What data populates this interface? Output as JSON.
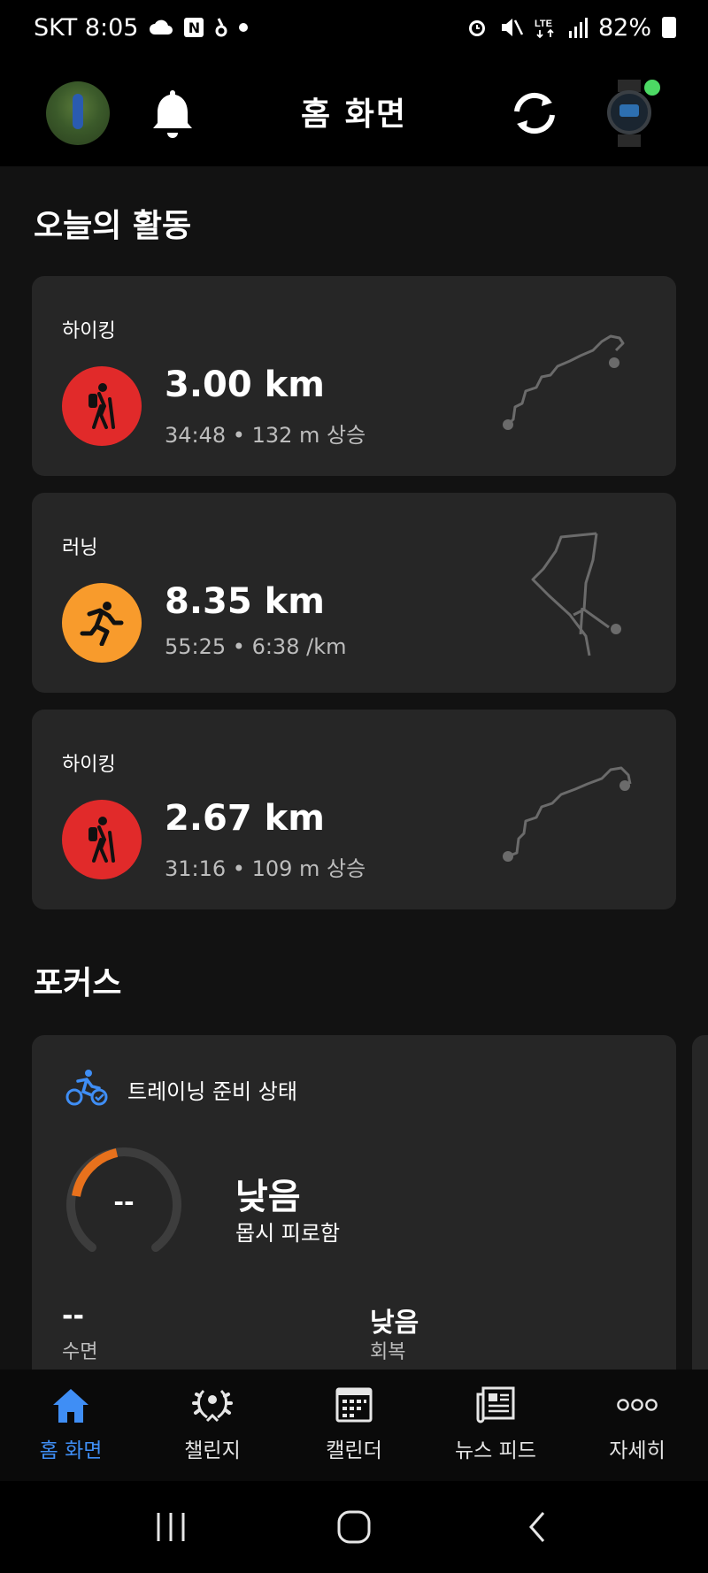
{
  "status_bar": {
    "carrier_time": "SKT 8:05",
    "n_badge": "N",
    "right_text": "82%"
  },
  "header": {
    "title": "홈 화면"
  },
  "today": {
    "title": "오늘의 활동",
    "activities": [
      {
        "type": "하이킹",
        "distance": "3.00 km",
        "sub": "34:48 • 132 m 상승",
        "color": "#e12a2a"
      },
      {
        "type": "러닝",
        "distance": "8.35 km",
        "sub": "55:25 • 6:38 /km",
        "color": "#f89b2c"
      },
      {
        "type": "하이킹",
        "distance": "2.67 km",
        "sub": "31:16 • 109 m 상승",
        "color": "#e12a2a"
      }
    ]
  },
  "focus": {
    "title": "포커스",
    "card_title": "트레이닝 준비 상태",
    "gauge_value": "--",
    "status": "낮음",
    "description": "몹시 피로함",
    "stats": [
      {
        "value": "--",
        "label": "수면"
      },
      {
        "value": "낮음",
        "label": "회복"
      }
    ]
  },
  "bottom_nav": {
    "items": [
      {
        "label": "홈 화면",
        "icon": "home-icon",
        "active": true
      },
      {
        "label": "챌린지",
        "icon": "laurel-icon",
        "active": false
      },
      {
        "label": "캘린더",
        "icon": "calendar-icon",
        "active": false
      },
      {
        "label": "뉴스 피드",
        "icon": "newsfeed-icon",
        "active": false
      },
      {
        "label": "자세히",
        "icon": "more-icon",
        "active": false
      }
    ]
  },
  "colors": {
    "accent": "#3f8ef5",
    "hiking": "#e12a2a",
    "running": "#f89b2c",
    "gauge_active": "#e8711c",
    "online": "#4cd964"
  }
}
